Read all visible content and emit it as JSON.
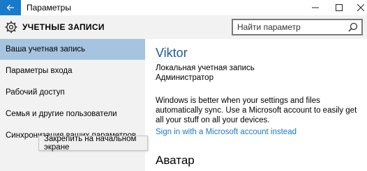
{
  "window": {
    "title": "Параметры",
    "back_icon": "back-arrow-icon",
    "minimize_icon": "minimize-icon",
    "maximize_icon": "maximize-icon",
    "close_icon": "close-icon"
  },
  "header": {
    "icon": "gear-icon",
    "title": "УЧЕТНЫЕ ЗАПИСИ"
  },
  "search": {
    "placeholder": "Найти параметр",
    "value": "",
    "icon": "search-icon"
  },
  "sidebar": {
    "items": [
      {
        "label": "Ваша учетная запись",
        "active": true
      },
      {
        "label": "Параметры входа",
        "active": false
      },
      {
        "label": "Рабочий доступ",
        "active": false
      },
      {
        "label": "Семья и другие пользователи",
        "active": false
      },
      {
        "label": "Синхронизация ваших параметров",
        "active": false
      }
    ]
  },
  "tooltip": {
    "text": "Закрепить на начальном экране"
  },
  "main": {
    "user_name": "Viktor",
    "account_type": "Локальная учетная запись",
    "role": "Администратор",
    "sync_message": "Windows is better when your settings and files automatically sync. Use a Microsoft account to easily get all your stuff on all your devices.",
    "ms_link": "Sign in with a Microsoft account instead",
    "avatar_heading": "Аватар"
  },
  "colors": {
    "accent": "#1979ca",
    "sidebar_bg": "#f2f2f2",
    "active_item_bg": "#a6c4e0",
    "user_name_color": "#1f5b99"
  }
}
